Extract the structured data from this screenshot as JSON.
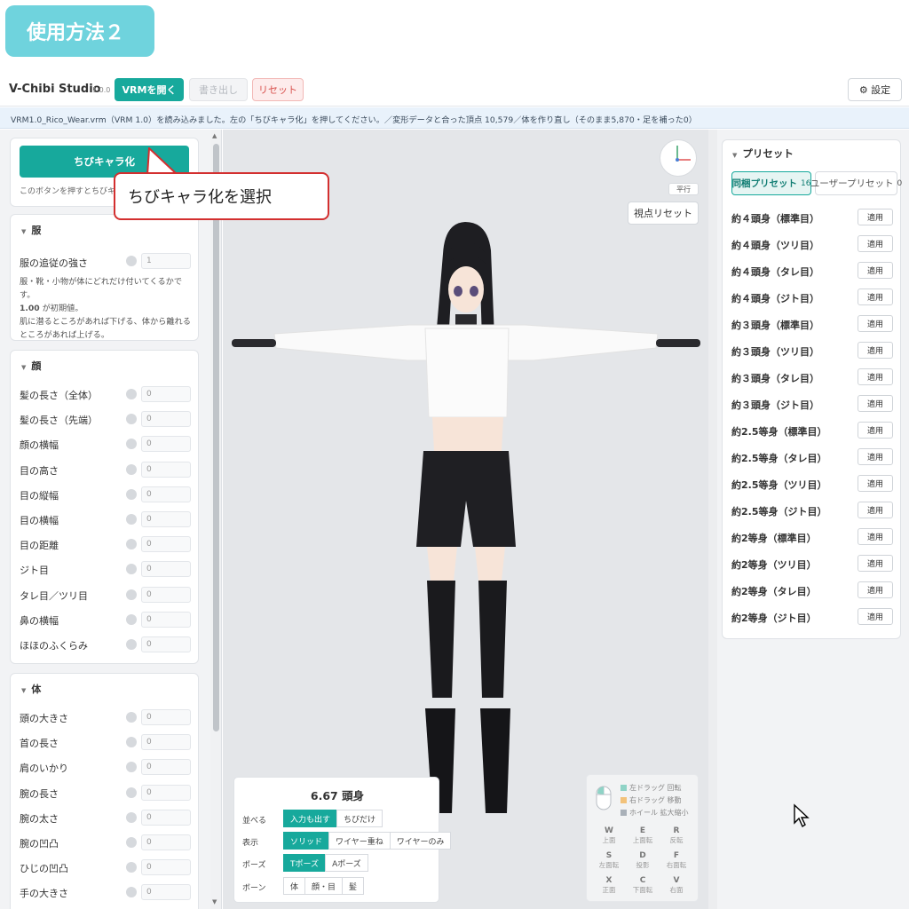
{
  "banner": {
    "label": "使用方法２"
  },
  "app": {
    "title": "V-Chibi Studio",
    "version": "1.0.0"
  },
  "toolbar": {
    "open_label": "VRMを開く",
    "export_label": "書き出し",
    "reset_label": "リセット",
    "settings_label": "⚙ 設定"
  },
  "status": {
    "message": "VRM1.0_Rico_Wear.vrm（VRM 1.0）を読み込みました。左の「ちびキャラ化」を押してください。／変形データと合った頂点 10,579／体を作り直し（そのまま5,870・足を補った0）"
  },
  "left": {
    "chibi_button": "ちびキャラ化",
    "chibi_hint": "このボタンを押すとちびキャ",
    "clothes": {
      "title": "服",
      "follow_label": "服の追従の強さ",
      "follow_value": "1",
      "desc1": "服・靴・小物が体にどれだけ付いてくるかです。",
      "desc2_bold": "1.00",
      "desc2_rest": " が初期値。",
      "desc3": "肌に潜るところがあれば下げる、体から離れるところがあれば上げる。"
    },
    "face": {
      "title": "顔",
      "rows": [
        {
          "label": "髪の長さ（全体）",
          "value": "0"
        },
        {
          "label": "髪の長さ（先端）",
          "value": "0"
        },
        {
          "label": "顔の横幅",
          "value": "0"
        },
        {
          "label": "目の高さ",
          "value": "0"
        },
        {
          "label": "目の縦幅",
          "value": "0"
        },
        {
          "label": "目の横幅",
          "value": "0"
        },
        {
          "label": "目の距離",
          "value": "0"
        },
        {
          "label": "ジト目",
          "value": "0"
        },
        {
          "label": "タレ目／ツリ目",
          "value": "0"
        },
        {
          "label": "鼻の横幅",
          "value": "0"
        },
        {
          "label": "ほほのふくらみ",
          "value": "0"
        }
      ]
    },
    "body": {
      "title": "体",
      "rows": [
        {
          "label": "頭の大きさ",
          "value": "0"
        },
        {
          "label": "首の長さ",
          "value": "0"
        },
        {
          "label": "肩のいかり",
          "value": "0"
        },
        {
          "label": "腕の長さ",
          "value": "0"
        },
        {
          "label": "腕の太さ",
          "value": "0"
        },
        {
          "label": "腕の凹凸",
          "value": "0"
        },
        {
          "label": "ひじの凹凸",
          "value": "0"
        },
        {
          "label": "手の大きさ",
          "value": "0"
        }
      ]
    }
  },
  "viewport": {
    "perspective_label": "平行",
    "view_reset_label": "視点リセット",
    "head_count": "6.67 頭身",
    "arrange": {
      "label": "並べる",
      "options": [
        "入力も出す",
        "ちびだけ"
      ]
    },
    "display": {
      "label": "表示",
      "options": [
        "ソリッド",
        "ワイヤー重ね",
        "ワイヤーのみ"
      ]
    },
    "pose": {
      "label": "ポーズ",
      "options": [
        "Tポーズ",
        "Aポーズ"
      ]
    },
    "bone": {
      "label": "ボーン",
      "options": [
        "体",
        "顔・目",
        "髪"
      ]
    },
    "mouse_help": [
      {
        "text": "左ドラッグ 回転",
        "color": "#8fd3c6"
      },
      {
        "text": "右ドラッグ 移動",
        "color": "#f2c27a"
      },
      {
        "text": "ホイール 拡大縮小",
        "color": "#a9b0b8"
      }
    ],
    "keys": [
      {
        "key": "W",
        "desc": "上面"
      },
      {
        "key": "E",
        "desc": "上面転"
      },
      {
        "key": "R",
        "desc": "反転"
      },
      {
        "key": "S",
        "desc": "左面転"
      },
      {
        "key": "D",
        "desc": "投影"
      },
      {
        "key": "F",
        "desc": "右面転"
      },
      {
        "key": "X",
        "desc": "正面"
      },
      {
        "key": "C",
        "desc": "下面転"
      },
      {
        "key": "V",
        "desc": "右面"
      }
    ]
  },
  "presets": {
    "title": "プリセット",
    "tab_bundled": "同梱プリセット",
    "tab_bundled_count": "16",
    "tab_user": "ユーザープリセット",
    "tab_user_count": "0",
    "apply_label": "適用",
    "items": [
      "約４頭身（標準目）",
      "約４頭身（ツリ目）",
      "約４頭身（タレ目）",
      "約４頭身（ジト目）",
      "約３頭身（標準目）",
      "約３頭身（ツリ目）",
      "約３頭身（タレ目）",
      "約３頭身（ジト目）",
      "約2.5等身（標準目）",
      "約2.5等身（タレ目）",
      "約2.5等身（ツリ目）",
      "約2.5等身（ジト目）",
      "約2等身（標準目）",
      "約2等身（ツリ目）",
      "約2等身（タレ目）",
      "約2等身（ジト目）"
    ]
  },
  "callout": {
    "text": "ちびキャラ化を選択"
  }
}
